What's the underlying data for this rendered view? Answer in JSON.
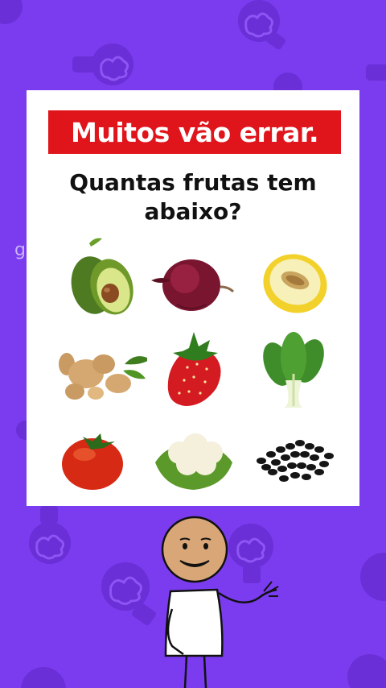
{
  "watermark": "g",
  "banner": {
    "text": "Muitos vão errar."
  },
  "question": {
    "line1": "Quantas frutas tem",
    "line2": "abaixo?"
  },
  "items": [
    {
      "name": "avocado",
      "icon": "avocado-icon"
    },
    {
      "name": "red onion",
      "icon": "red-onion-icon"
    },
    {
      "name": "melon",
      "icon": "melon-icon"
    },
    {
      "name": "ginger",
      "icon": "ginger-icon"
    },
    {
      "name": "strawberry",
      "icon": "strawberry-icon"
    },
    {
      "name": "bok choy",
      "icon": "bok-choy-icon"
    },
    {
      "name": "tomato",
      "icon": "tomato-icon"
    },
    {
      "name": "cauliflower",
      "icon": "cauliflower-icon"
    },
    {
      "name": "black beans",
      "icon": "black-beans-icon"
    }
  ],
  "colors": {
    "background": "#7b3cf0",
    "banner": "#e0141b",
    "card": "#ffffff"
  }
}
